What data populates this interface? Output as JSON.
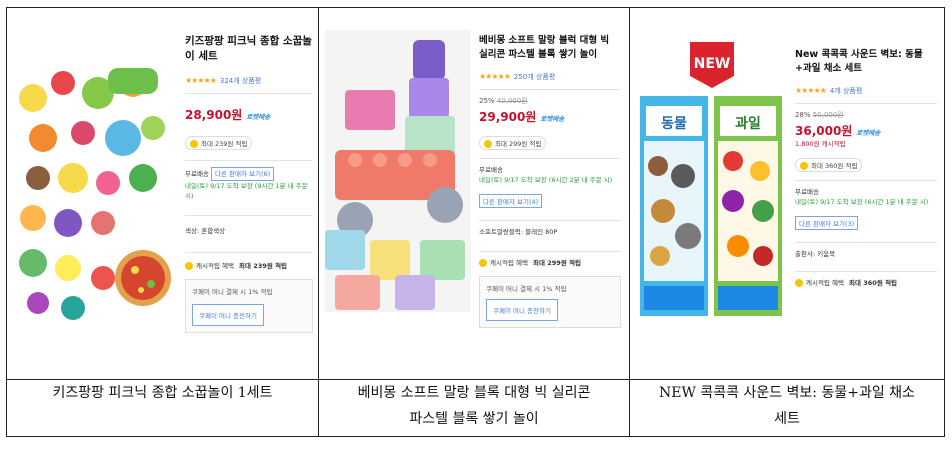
{
  "columns": [
    {
      "caption": "키즈팡팡 피크닉 종합 소꿉놀이 1세트",
      "panel": {
        "title": "키즈팡팡 피크닉 종합 소꿉놀이 세트",
        "stars": "★★★★★",
        "reviews": "324개 상품평",
        "price": "28,900원",
        "rocket": "로켓배송",
        "reward": "최대 239원 적립",
        "shipping": "무료배송",
        "other_seller": "다른 판매자 보기(6)",
        "delivery": "내일(토) 9/17 도착 보장 (9시간 1분 내 주문 시)",
        "option": "색상: 혼합색상",
        "cash_label": "캐시적립 혜택",
        "cash_value": "최대 239원 적립",
        "coupay_text": "쿠페이 머니 결제 시 1% 적립",
        "coupay_button": "쿠페이 머니 충전하기"
      }
    },
    {
      "caption_line1": "베비몽 소프트 말랑 블록 대형 빅 실리콘",
      "caption_line2": "파스텔 블록 쌓기 놀이",
      "panel": {
        "title": "베비몽 소프트 말랑 블럭 대형 빅 실리콘 파스텔 블록 쌓기 놀이",
        "stars": "★★★★★",
        "reviews": "250개 상품평",
        "discount": "25%",
        "orig_price": "40,000원",
        "price": "29,900원",
        "rocket": "로켓배송",
        "reward": "최대 299원 적립",
        "shipping": "무료배송",
        "delivery": "내일(토) 9/17 도착 보장 (6시간 2분 내 주문 시)",
        "other_seller": "다른 판매자 보기(4)",
        "option": "소프트말랑블럭: 블레인 80P",
        "cash_label": "캐시적립 혜택",
        "cash_value": "최대 299원 적립",
        "coupay_text": "쿠페이 머니 결제 시 1% 적립",
        "coupay_button": "쿠페이 머니 충전하기"
      }
    },
    {
      "caption_line1": "NEW 콕콕콕 사운드 벽보: 동물+과일 채소",
      "caption_line2": "세트",
      "panel": {
        "badge": "NEW",
        "poster_left": "동물",
        "poster_right": "과일",
        "title": "New 콕콕콕 사운드 벽보: 동물+과일 채소 세트",
        "stars": "★★★★★",
        "reviews": "4개 상품평",
        "discount": "28%",
        "orig_price": "50,000원",
        "price": "36,000원",
        "rocket": "로켓배송",
        "cash_line": "1,800원 캐시적립",
        "reward": "최대 360원 적립",
        "shipping": "무료배송",
        "delivery": "내일(토) 9/17 도착 보장 (6시간 1분 내 주문 시)",
        "other_seller": "다른 판매자 보기(3)",
        "option": "출판사: 키움북",
        "cash_label": "캐시적립 혜택",
        "cash_value": "최대 360원 적립"
      }
    }
  ]
}
